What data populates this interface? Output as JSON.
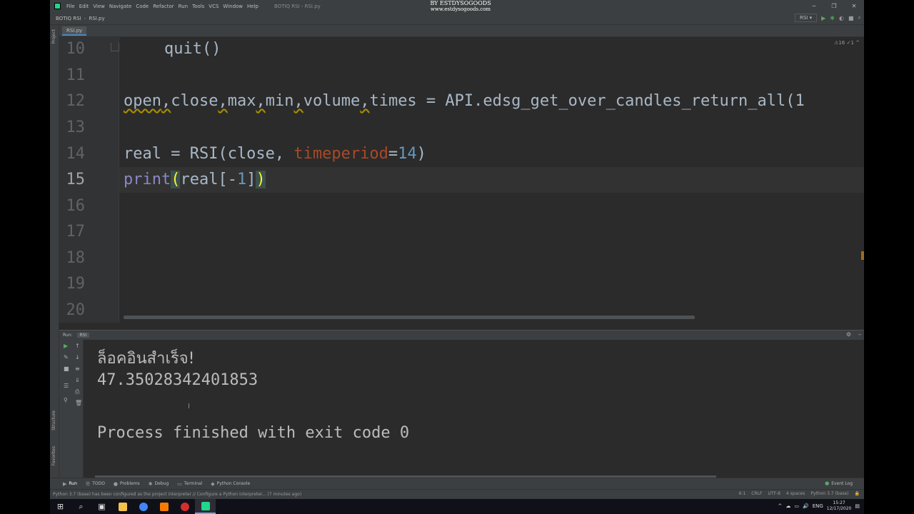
{
  "title_bar": {
    "menu": [
      "File",
      "Edit",
      "View",
      "Navigate",
      "Code",
      "Refactor",
      "Run",
      "Tools",
      "VCS",
      "Window",
      "Help"
    ],
    "file_title": "BOTIQ RSI - RSI.py",
    "watermark_line1": "BY ESTDYSOGOODS",
    "watermark_line2": "www.estdysogoods.com",
    "win_minimize": "─",
    "win_restore": "❐",
    "win_close": "✕"
  },
  "nav_bar": {
    "project": "BOTIQ RSI",
    "file": "RSI.py",
    "run_config": "RSI ▾"
  },
  "left_strip": {
    "project_label": "Project",
    "structure_label": "Structure",
    "favorites_label": "Favorites"
  },
  "editor_tab": {
    "label": "RSI.py"
  },
  "editor": {
    "inspection_info": "⚠16 ✓1 ^",
    "line_numbers": [
      "10",
      "11",
      "12",
      "13",
      "14",
      "15",
      "16",
      "17",
      "18",
      "19",
      "20"
    ],
    "line10": "quit()",
    "line12": {
      "open": "open",
      "close": "close",
      "max": "max",
      "min": "min",
      "volume": "volume",
      "rest": "times = API.edsg_get_over_candles_return_all(1"
    },
    "line14": {
      "prefix": "real = RSI(close, ",
      "param": "timeperiod",
      "eq": "=",
      "num": "14",
      "suffix": ")"
    },
    "line15": {
      "print": "print",
      "open_paren": "(",
      "mid": "real[-",
      "num": "1",
      "close_bracket": "]",
      "close_paren": ")"
    }
  },
  "run_panel": {
    "header_label": "Run:",
    "tab_label": "RSI",
    "console": {
      "line1": "ล็อคอินสำเร็จ!",
      "line2": "47.35028342401853",
      "line3": "Process finished with exit code 0"
    }
  },
  "bottom_tabs": {
    "run": "Run",
    "todo": "TODO",
    "problems": "Problems",
    "debug": "Debug",
    "terminal": "Terminal",
    "python_console": "Python Console",
    "event_log": "Event Log"
  },
  "status_bar": {
    "message": "Python 3.7 (base) has been configured as the project interpreter // Configure a Python interpreter... (7 minutes ago)",
    "position": "6:1",
    "line_sep": "CRLF",
    "encoding": "UTF-8",
    "indent": "4 spaces",
    "interpreter": "Python 3.7 (base)"
  },
  "taskbar": {
    "language": "ENG",
    "time": "15:27",
    "date": "12/17/2020"
  },
  "colors": {
    "editor_bg": "#2b2b2b",
    "panel_bg": "#3c3f41",
    "builtin": "#8888c6",
    "param": "#aa4926",
    "number": "#6897bb",
    "text": "#a9b7c6"
  }
}
